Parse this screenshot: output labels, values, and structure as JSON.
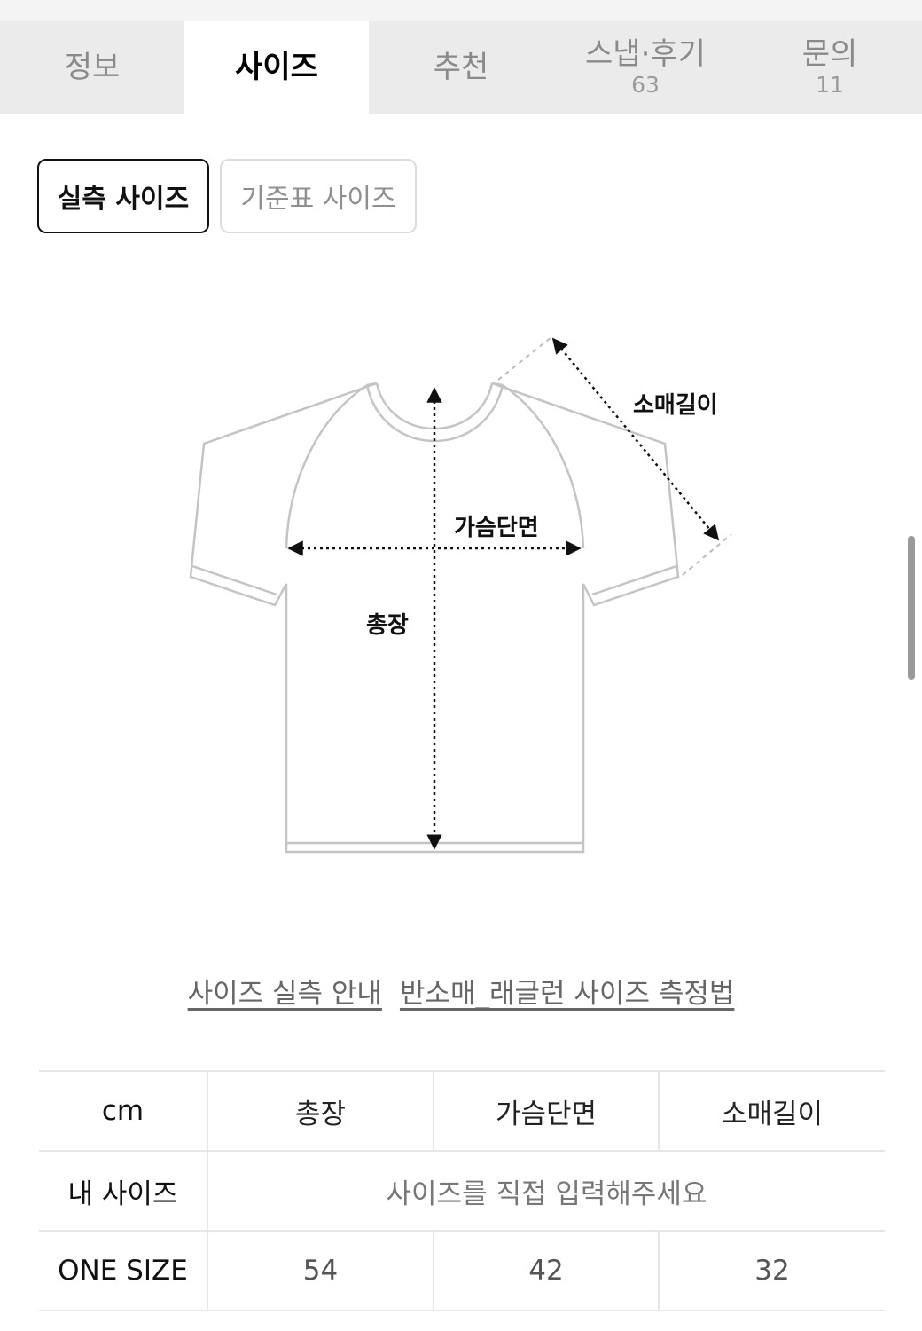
{
  "tabs": [
    {
      "label": "정보",
      "count": ""
    },
    {
      "label": "사이즈",
      "count": ""
    },
    {
      "label": "추천",
      "count": ""
    },
    {
      "label": "스냅·후기",
      "count": "63"
    },
    {
      "label": "문의",
      "count": "11"
    }
  ],
  "active_tab": "사이즈",
  "size_toggle": {
    "measured": "실측 사이즈",
    "standard": "기준표 사이즈"
  },
  "diagram": {
    "sleeve_length": "소매길이",
    "chest_width": "가슴단면",
    "total_length": "총장"
  },
  "links": {
    "guide": "사이즈 실측 안내",
    "method": "반소매_래글런 사이즈 측정법"
  },
  "table": {
    "headers": [
      "cm",
      "총장",
      "가슴단면",
      "소매길이"
    ],
    "my_size": {
      "label": "내 사이즈",
      "placeholder": "사이즈를 직접 입력해주세요"
    },
    "rows": [
      {
        "label": "ONE SIZE",
        "values": [
          "54",
          "42",
          "32"
        ]
      }
    ]
  },
  "colors": {
    "tab_bar": "#ebebeb",
    "active_tab": "#ffffff",
    "border": "#e6e6e6"
  }
}
